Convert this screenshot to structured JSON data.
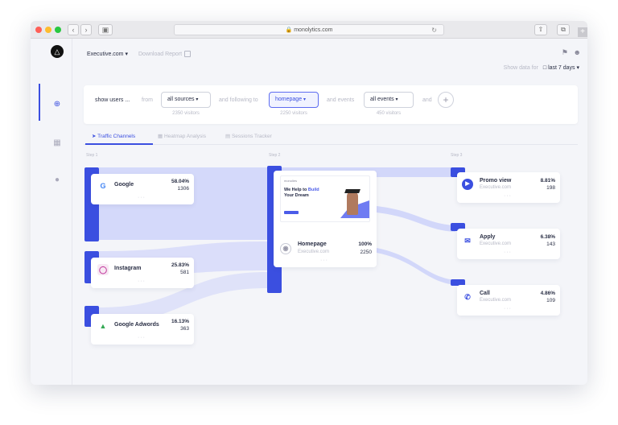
{
  "browser": {
    "url": "monolytics.com"
  },
  "topbar": {
    "site": "Executive.com",
    "download": "Download Report",
    "show_data_label": "Show data for",
    "range": "last 7 days"
  },
  "filter": {
    "show_users": "show users ...",
    "from": "from",
    "source": "all sources",
    "source_sub": "2350 visitors",
    "following": "and following to",
    "page": "homepage",
    "page_sub": "2250 visitors",
    "and_events": "and events",
    "events": "all events",
    "events_sub": "450 visitors",
    "and": "and"
  },
  "tabs": [
    "Traffic Channels",
    "Heatmap Analysis",
    "Sessions Tracker"
  ],
  "steps": [
    "Step 1",
    "Step 2",
    "Step 3"
  ],
  "sources": [
    {
      "name": "Google",
      "pct": "58.04%",
      "count": "1306"
    },
    {
      "name": "Instagram",
      "pct": "25.83%",
      "count": "581"
    },
    {
      "name": "Google Adwords",
      "pct": "16.13%",
      "count": "363"
    }
  ],
  "homepage": {
    "name": "Homepage",
    "site": "Executive.com",
    "pct": "100%",
    "count": "2250",
    "preview": {
      "logo": "monolies",
      "headline1": "We Help to",
      "headline_accent": "Build",
      "headline2": "Your Dream"
    }
  },
  "events": [
    {
      "name": "Promo view",
      "site": "Executive.com",
      "pct": "8.81%",
      "count": "198"
    },
    {
      "name": "Apply",
      "site": "Executive.com",
      "pct": "6.38%",
      "count": "143"
    },
    {
      "name": "Call",
      "site": "Executive.com",
      "pct": "4.86%",
      "count": "109"
    }
  ],
  "colors": {
    "accent": "#3b4fe0",
    "flow": "#c9cffa"
  }
}
